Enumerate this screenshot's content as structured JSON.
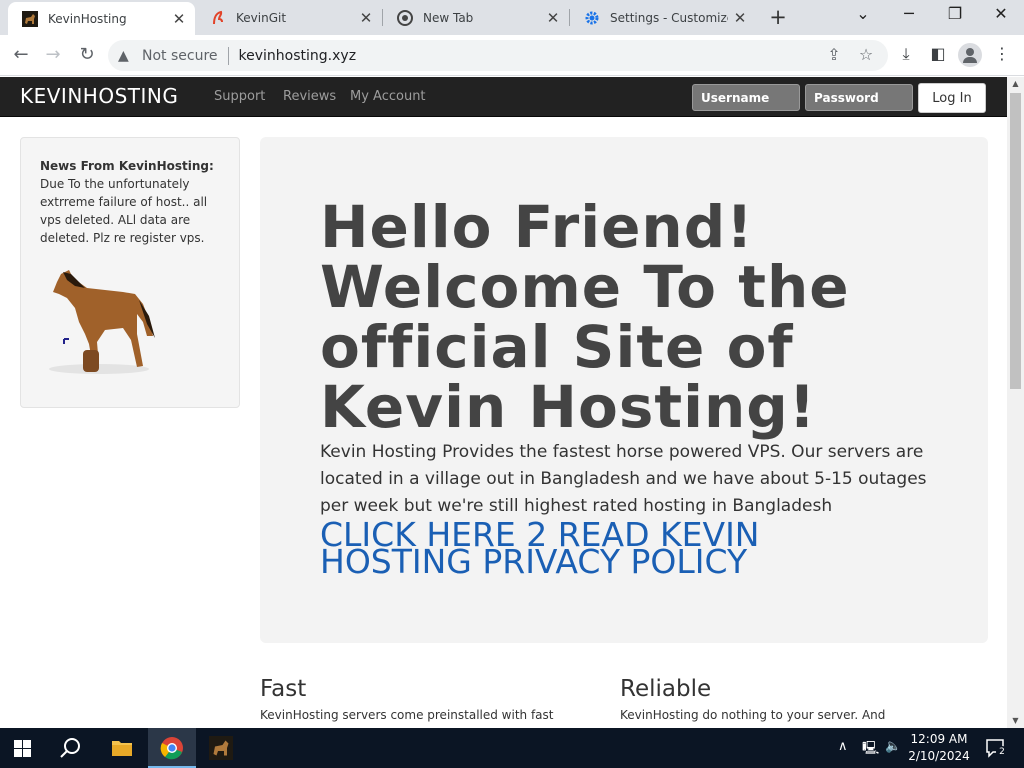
{
  "browser": {
    "tabs": [
      {
        "title": "KevinHosting",
        "active": true,
        "icon": "horse-favicon"
      },
      {
        "title": "KevinGit",
        "active": false,
        "icon": "git-favicon"
      },
      {
        "title": "New Tab",
        "active": false,
        "icon": "chrome-favicon"
      },
      {
        "title": "Settings - Customize f",
        "active": false,
        "icon": "settings-favicon"
      }
    ],
    "new_tab_label": "+",
    "omnibox": {
      "security_label": "Not secure",
      "url": "kevinhosting.xyz"
    }
  },
  "site": {
    "brand": "KEVINHOSTING",
    "nav_links": [
      "Support",
      "Reviews",
      "My Account"
    ],
    "username_placeholder": "Username",
    "password_placeholder": "Password",
    "login_label": "Log In",
    "news": {
      "title": "News From KevinHosting:",
      "body": "Due To the unfortunately extrreme failure of host.. all vps deleted. ALl data are deleted. Plz re register vps."
    },
    "hero": {
      "title": "Hello Friend! Welcome To the official Site of Kevin Hosting!",
      "text": "Kevin Hosting Provides the fastest horse powered VPS. Our servers are located in a village out in Bangladesh and we have about 5-15 outages per week but we're still highest rated hosting in Bangladesh",
      "link": "CLICK HERE 2 READ KEVIN HOSTING PRIVACY POLICY"
    },
    "features": [
      {
        "title": "Fast",
        "text": "KevinHosting servers come preinstalled with fast"
      },
      {
        "title": "Reliable",
        "text": "KevinHosting do nothing to your server. And"
      }
    ]
  },
  "taskbar": {
    "time": "12:09 AM",
    "date": "2/10/2024",
    "notification_count": "2"
  },
  "colors": {
    "navbar": "#222222",
    "link": "#1a5fb4",
    "jumbotron": "#f3f3f3",
    "taskbar": "#0b1524"
  }
}
